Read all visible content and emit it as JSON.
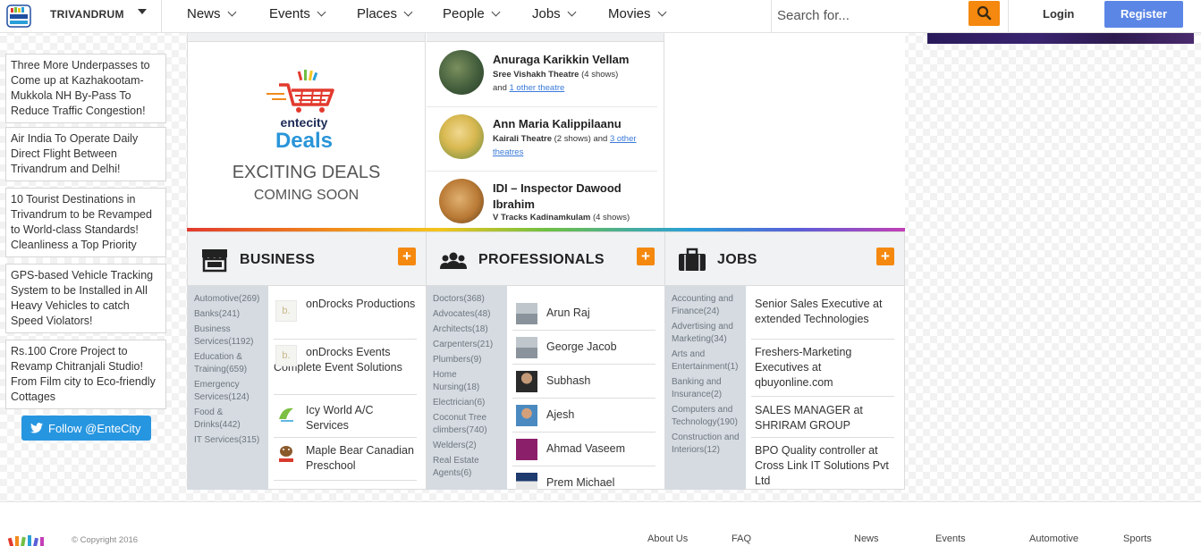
{
  "header": {
    "logo_text": "ente city",
    "city": "TRIVANDRUM",
    "nav": [
      "News",
      "Events",
      "Places",
      "People",
      "Jobs",
      "Movies"
    ],
    "search_placeholder": "Search for...",
    "login": "Login",
    "register": "Register"
  },
  "sidebar": {
    "news": [
      "Three More Underpasses to Come up at Kazhakootam-Mukkola NH By-Pass To Reduce Traffic Congestion!",
      "Air India To Operate Daily Direct Flight Between Trivandrum and Delhi!",
      "10 Tourist Destinations in Trivandrum to be Revamped to World-class Standards! Cleanliness a Top Priority",
      "GPS-based Vehicle Tracking System to be Installed in All Heavy Vehicles to catch Speed Violators!",
      "Rs.100 Crore Project to Revamp Chitranjali Studio! From Film city to Eco-friendly Cottages"
    ],
    "follow": "Follow @EnteCity"
  },
  "deals": {
    "logo_line1": "entecity",
    "logo_line2": "Deals",
    "title": "EXCITING DEALS",
    "subtitle": "COMING SOON"
  },
  "movies": [
    {
      "title": "Anuraga Karikkin Vellam",
      "theatre": "Sree Vishakh Theatre",
      "shows": "(4 shows)",
      "and": "and",
      "more": "1 other theatre",
      "thumb_color": "#3f5a3a"
    },
    {
      "title": "Ann Maria Kalippilaanu",
      "theatre": "Kairali Theatre",
      "shows": "(2 shows) and",
      "and": "",
      "more": "3 other theatres",
      "thumb_color": "#d8b850"
    },
    {
      "title": "IDI – Inspector Dawood Ibrahim",
      "theatre": "V Tracks Kadinamkulam",
      "shows": "(4 shows)",
      "and": "",
      "more": "",
      "thumb_color": "#b97a35"
    }
  ],
  "categories": {
    "business": {
      "title": "BUSINESS",
      "plus": "+",
      "side": [
        "Automotive(269)",
        "Banks(241)",
        "Business Services(1192)",
        "Education & Training(659)",
        "Emergency Services(124)",
        "Food & Drinks(442)",
        "IT Services(315)"
      ],
      "items": [
        "onDrocks Productions",
        "onDrocks Events Complete Event Solutions",
        "Icy World A/C Services",
        "Maple Bear Canadian Preschool"
      ]
    },
    "professionals": {
      "title": "PROFESSIONALS",
      "plus": "+",
      "side": [
        "Doctors(368)",
        "Advocates(48)",
        "Architects(18)",
        "Carpenters(21)",
        "Plumbers(9)",
        "Home Nursing(18)",
        "Electrician(6)",
        "Coconut Tree climbers(740)",
        "Welders(2)",
        "Real Estate Agents(6)"
      ],
      "items": [
        "Arun Raj",
        "George Jacob",
        "Subhash",
        "Ajesh",
        "Ahmad Vaseem",
        "Prem Michael"
      ]
    },
    "jobs": {
      "title": "JOBS",
      "plus": "+",
      "side": [
        "Accounting and Finance(24)",
        "Advertising and Marketing(34)",
        "Arts and Entertainment(1)",
        "Banking and Insurance(2)",
        "Computers and Technology(190)",
        "Construction and Interiors(12)"
      ],
      "items": [
        "Senior Sales Executive at extended Technologies",
        "Freshers-Marketing Executives at qbuyonline.com",
        "SALES MANAGER at SHRIRAM GROUP",
        "BPO Quality controller at Cross Link IT Solutions Pvt Ltd"
      ]
    }
  },
  "footer": {
    "copyright": "© Copyright 2016",
    "links": [
      "About Us",
      "FAQ",
      "News",
      "Events",
      "Automotive",
      "Sports"
    ]
  },
  "colors": {
    "accent": "#f5880e",
    "register": "#5b86e5",
    "twitter": "#2796e0",
    "link": "#3a7ad8"
  }
}
